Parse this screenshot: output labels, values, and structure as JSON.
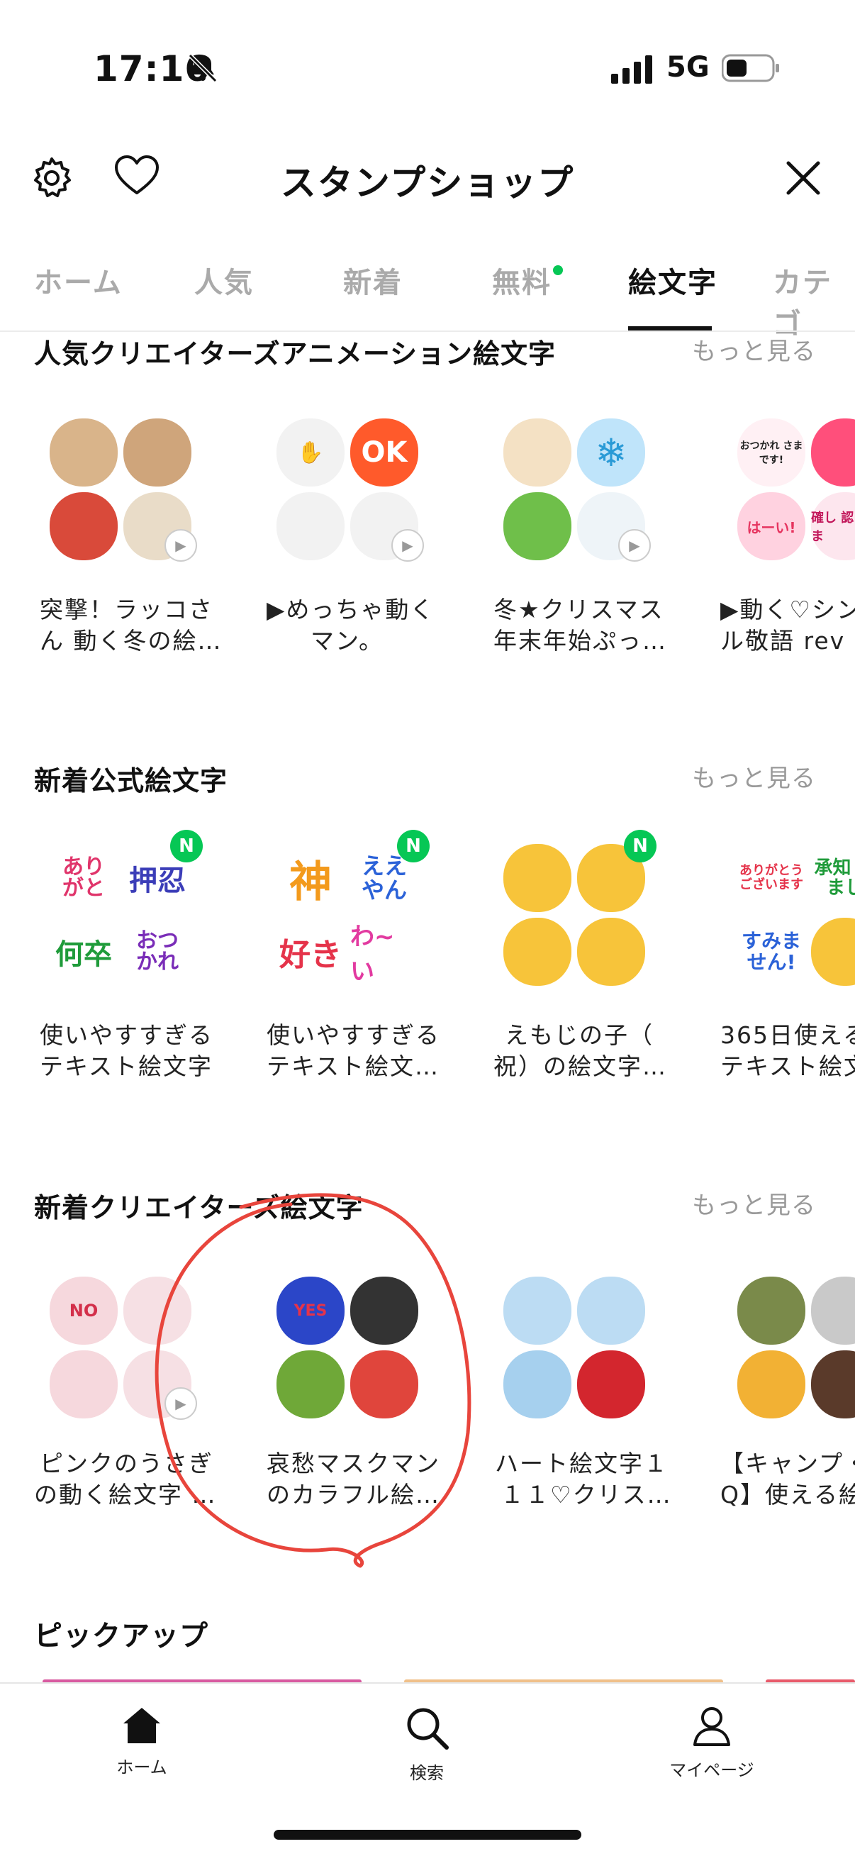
{
  "status": {
    "time": "17:16",
    "network": "5G"
  },
  "header": {
    "title": "スタンプショップ"
  },
  "tabs": [
    {
      "label": "ホーム"
    },
    {
      "label": "人気"
    },
    {
      "label": "新着"
    },
    {
      "label": "無料"
    },
    {
      "label": "絵文字"
    },
    {
      "label": "カテゴ"
    }
  ],
  "active_tab": "絵文字",
  "sections": [
    {
      "title": "人気クリエイターズアニメーション絵文字",
      "more": "もっと見る",
      "items": [
        {
          "line1": "突撃！ラッコさ",
          "line2": "ん 動く冬の絵…"
        },
        {
          "line1": "▶めっちゃ動く",
          "line2": "マン。"
        },
        {
          "line1": "冬★クリスマス",
          "line2": "年末年始ぷっ…"
        },
        {
          "line1": "▶動く♡シン",
          "line2": "ル敬語 rev"
        }
      ]
    },
    {
      "title": "新着公式絵文字",
      "more": "もっと見る",
      "items": [
        {
          "line1": "使いやすすぎる",
          "line2": "テキスト絵文字",
          "badge": "N"
        },
        {
          "line1": "使いやすすぎる",
          "line2": "テキスト絵文…",
          "badge": "N"
        },
        {
          "line1": "えもじの子（",
          "line2": "祝）の絵文字…",
          "badge": "N"
        },
        {
          "line1": "365日使える",
          "line2": "テキスト絵文"
        }
      ]
    },
    {
      "title": "新着クリエイターズ絵文字",
      "more": "もっと見る",
      "items": [
        {
          "line1": "ピンクのうさぎ",
          "line2": "の動く絵文字 …"
        },
        {
          "line1": "哀愁マスクマン",
          "line2": "のカラフル絵…"
        },
        {
          "line1": "ハート絵文字１",
          "line2": "１１♡クリス…"
        },
        {
          "line1": "【キャンプ・",
          "line2": "Q】使える絵"
        }
      ]
    }
  ],
  "pickup": {
    "title": "ピックアップ"
  },
  "sticker_text": {
    "ok": "OK",
    "yes": "YES",
    "no": "NO",
    "g1": [
      "あり がと",
      "押忍",
      "何卒",
      "おつ かれ"
    ],
    "g2": [
      "神",
      "ええ やん",
      "好き",
      "わ~い"
    ],
    "g3": [
      "ありがとう ございます",
      "承知 しまし",
      "すみま せん!"
    ],
    "g4": [
      "おつかれ さまです!",
      "はーい!",
      "確し 認しま"
    ]
  },
  "bottom_nav": [
    {
      "label": "ホーム"
    },
    {
      "label": "検索"
    },
    {
      "label": "マイページ"
    }
  ],
  "annotation_color": "#e8453c"
}
